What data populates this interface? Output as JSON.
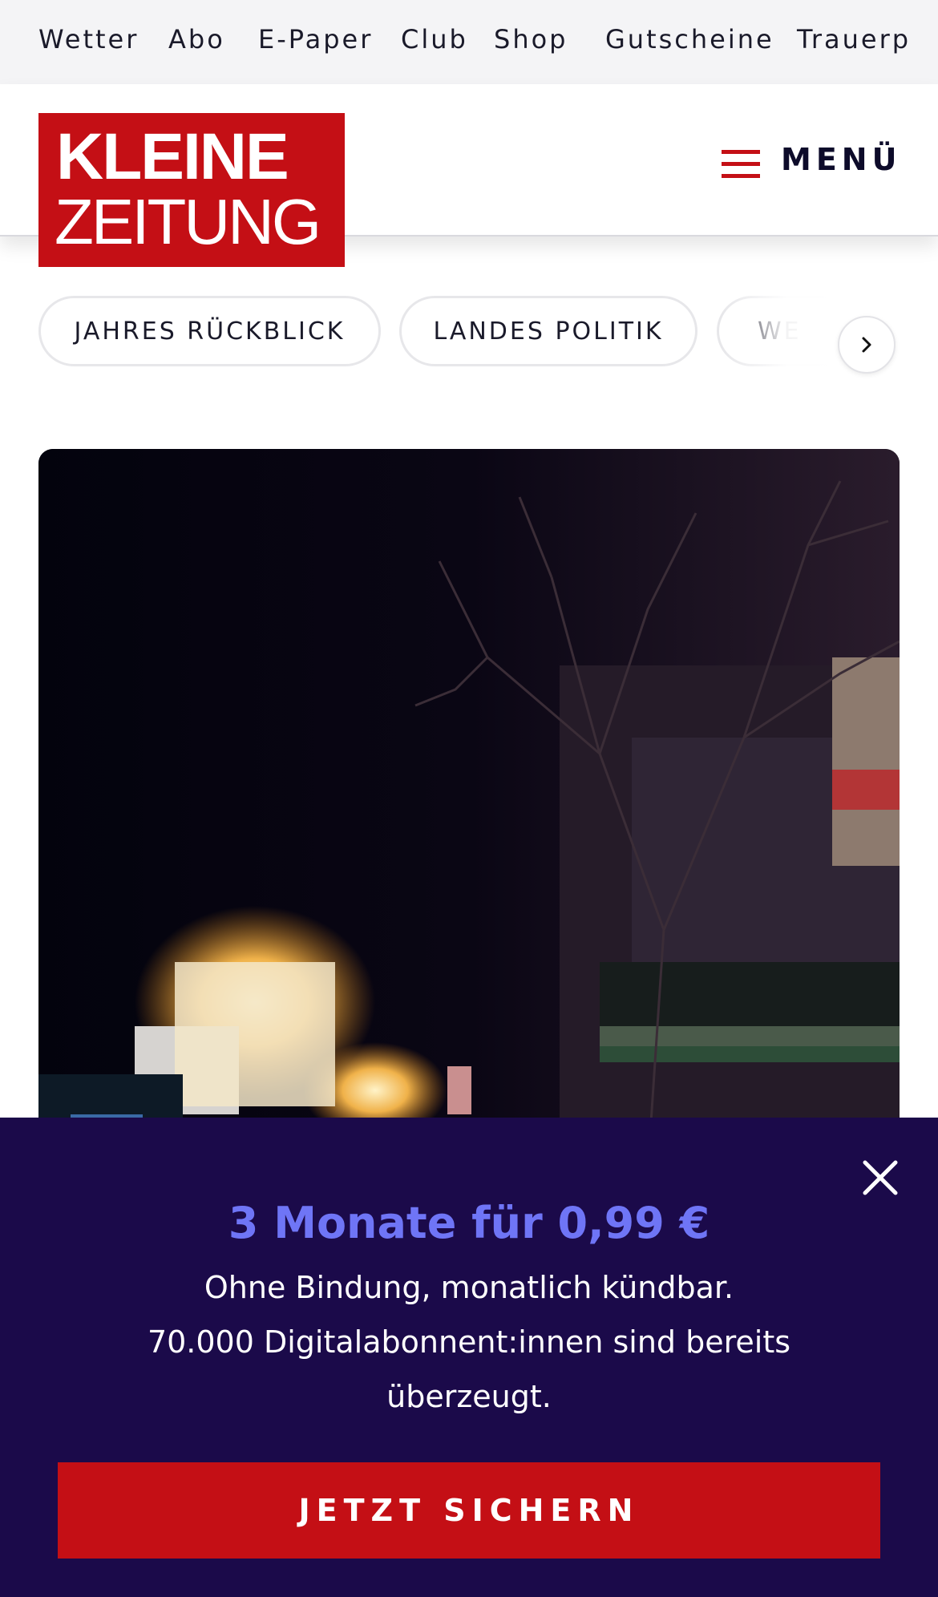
{
  "topnav": {
    "items": [
      {
        "label": "Wetter"
      },
      {
        "label": "Abo"
      },
      {
        "label": "E-Paper"
      },
      {
        "label": "Club"
      },
      {
        "label": "Shop"
      },
      {
        "label": "Gutscheine"
      },
      {
        "label": "Trauerp"
      }
    ]
  },
  "header": {
    "logo": {
      "line1": "KLEINE",
      "line2": "ZEITUNG",
      "color": "#c40f15"
    },
    "menu_label": "MENÜ"
  },
  "categories": {
    "pills": [
      {
        "label": "JAHRES RÜCKBLICK"
      },
      {
        "label": "LANDES POLITIK"
      },
      {
        "label": "WE"
      }
    ],
    "next_icon": "chevron-right-icon"
  },
  "hero": {
    "icon": "photo-night-christmas-market"
  },
  "promo": {
    "headline": "3 Monate für 0,99 €",
    "line1": "Ohne Bindung, monatlich kündbar.",
    "line2": "70.000 Digitalabonnent:innen sind bereits",
    "line3": "überzeugt.",
    "cta_label": "JETZT SICHERN",
    "close_icon": "close-icon",
    "background": "#1b0a4a",
    "headline_color": "#6f75f6",
    "cta_color": "#c40f15"
  }
}
